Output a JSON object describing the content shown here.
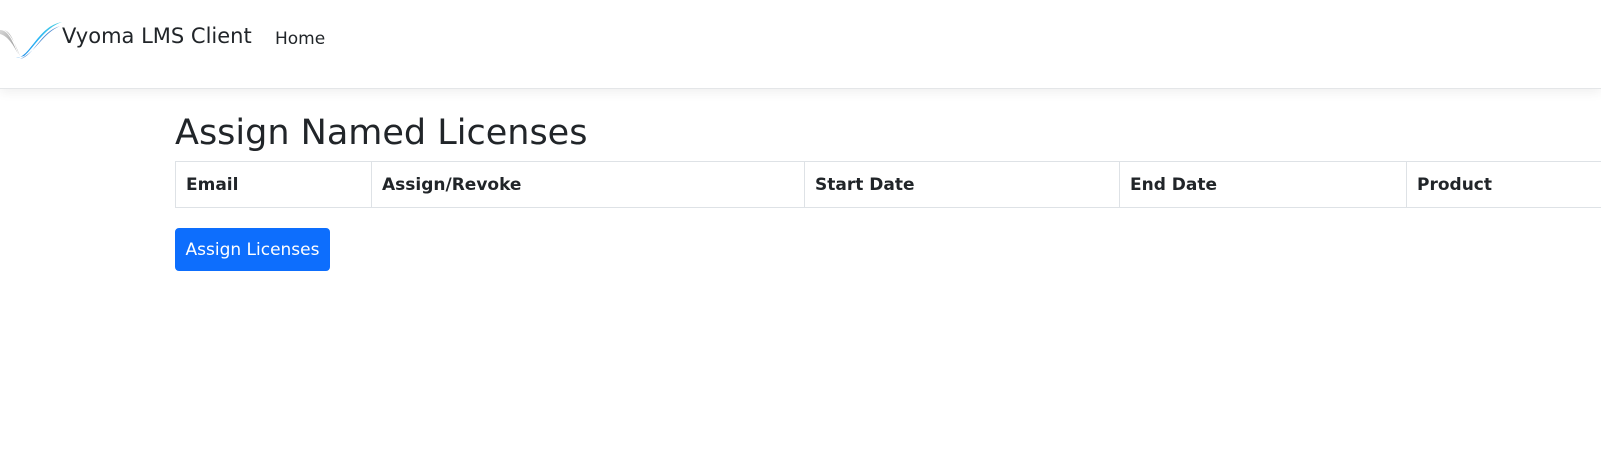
{
  "navbar": {
    "brand_name": "Vyoma LMS Client",
    "logo_icon": "vyoma-swoosh-logo-icon",
    "links": [
      "Home"
    ]
  },
  "page": {
    "title": "Assign Named Licenses"
  },
  "table": {
    "columns": [
      "Email",
      "Assign/Revoke",
      "Start Date",
      "End Date",
      "Product"
    ],
    "rows": []
  },
  "actions": {
    "assign_button_label": "Assign Licenses"
  },
  "colors": {
    "primary": "#0d6efd",
    "text": "#212529",
    "border": "#dee2e6"
  }
}
